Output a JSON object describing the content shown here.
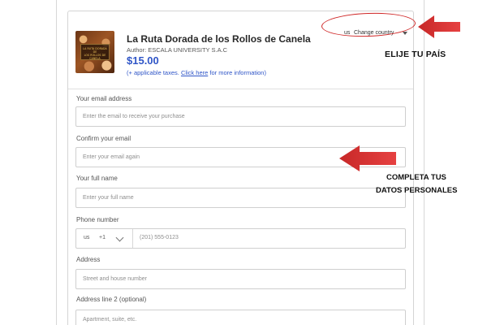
{
  "product": {
    "image_alt_text": "LA RUTA DORADA DE LOS ROLLOS DE CANELA",
    "image_lines": [
      "LA RUTA DORADA",
      "DE",
      "LOS ROLLOS DE CANELA"
    ],
    "title": "La Ruta Dorada de los Rollos de Canela",
    "author": "Author: ESCALA UNIVERSITY S.A.C",
    "price": "$15.00",
    "tax_prefix": "(+ applicable taxes.",
    "tax_link": "Click here",
    "tax_suffix": "for more information)"
  },
  "country_selector": {
    "code": "us",
    "label": "Change country",
    "icon": "caret-down-icon"
  },
  "annotations": {
    "country_callout": "ELIJE TU PAÍS",
    "personal_data_callout_line1": "COMPLETA TUS",
    "personal_data_callout_line2": "DATOS PERSONALES",
    "highlight_color": "#cf2626",
    "arrow_color": "#d92d2d"
  },
  "form": {
    "email": {
      "label": "Your email address",
      "placeholder": "Enter the email to receive your purchase"
    },
    "confirm_email": {
      "label": "Confirm your email",
      "placeholder": "Enter your email again"
    },
    "full_name": {
      "label": "Your full name",
      "placeholder": "Enter your full name"
    },
    "phone": {
      "label": "Phone number",
      "country_code": "us",
      "dial_code": "+1",
      "placeholder": "(201) 555-0123",
      "icon": "chevron-down-icon"
    },
    "address": {
      "label": "Address",
      "placeholder": "Street and house number"
    },
    "address_line_2": {
      "label": "Address line 2 (optional)",
      "placeholder": "Apartment, suite, etc."
    }
  }
}
